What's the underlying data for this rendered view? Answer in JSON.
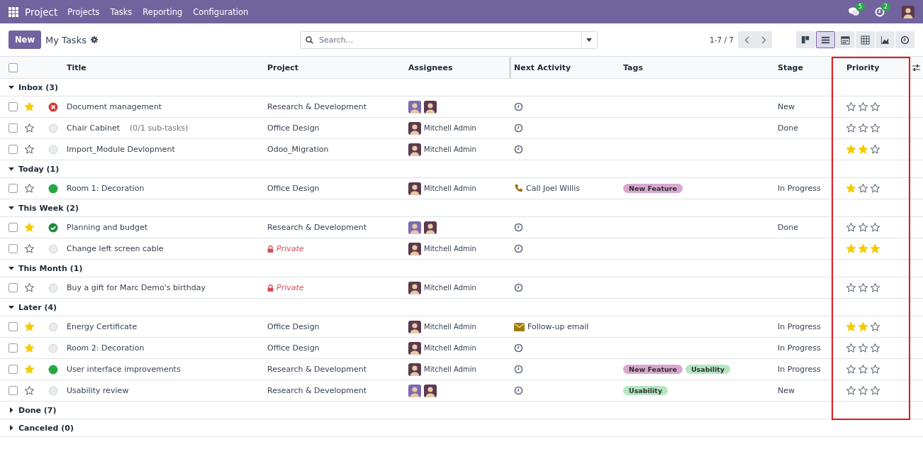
{
  "navbar": {
    "app": "Project",
    "menu": [
      "Projects",
      "Tasks",
      "Reporting",
      "Configuration"
    ],
    "messages_badge": "5",
    "activities_badge": "2"
  },
  "control_panel": {
    "new_button": "New",
    "title": "My Tasks",
    "search": {
      "placeholder": "Search..."
    },
    "pager": "1-7 / 7",
    "views": [
      {
        "kind": "kanban",
        "selected": false
      },
      {
        "kind": "list",
        "selected": true
      },
      {
        "kind": "calendar",
        "selected": false
      },
      {
        "kind": "pivot",
        "selected": false
      },
      {
        "kind": "graph",
        "selected": false
      },
      {
        "kind": "activity",
        "selected": false
      }
    ]
  },
  "table": {
    "all_checked": false,
    "columns": [
      {
        "label": "Title",
        "highlighted": false
      },
      {
        "label": "Project",
        "highlighted": false
      },
      {
        "label": "Assignees",
        "highlighted": false
      },
      {
        "label": "Next Activity",
        "highlighted": false
      },
      {
        "label": "Tags",
        "highlighted": false
      },
      {
        "label": "Stage",
        "highlighted": false
      },
      {
        "label": "Priority",
        "highlighted": true
      }
    ],
    "groups": [
      {
        "label": "Inbox (3)",
        "expanded": true,
        "rows": [
          {
            "checked": false,
            "favorite": true,
            "status": {
              "kind": "blocked"
            },
            "title": "Document management",
            "project": {
              "kind": "normal",
              "label": "Research & Development"
            },
            "avatars": [
              {
                "kind": "demo"
              },
              {
                "kind": "admin"
              }
            ],
            "activity": {
              "kind": "none"
            },
            "stage": "New",
            "stars": 0
          },
          {
            "checked": false,
            "favorite": false,
            "status": {
              "kind": "normal"
            },
            "title": "Chair Cabinet",
            "subtasks": "(0/1 sub-tasks)",
            "project": {
              "kind": "normal",
              "label": "Office Design"
            },
            "avatars": [
              {
                "kind": "admin"
              }
            ],
            "assignee": "Mitchell Admin",
            "activity": {
              "kind": "none"
            },
            "stage": "Done",
            "stars": 0
          },
          {
            "checked": false,
            "favorite": false,
            "status": {
              "kind": "normal"
            },
            "title": "Import_Module Devlopment",
            "project": {
              "kind": "normal",
              "label": "Odoo_Migration"
            },
            "avatars": [
              {
                "kind": "admin"
              }
            ],
            "assignee": "Mitchell Admin",
            "activity": {
              "kind": "none"
            },
            "stars": 2
          }
        ]
      },
      {
        "label": "Today (1)",
        "expanded": true,
        "rows": [
          {
            "checked": false,
            "favorite": false,
            "status": {
              "kind": "ready"
            },
            "title": "Room 1: Decoration",
            "project": {
              "kind": "normal",
              "label": "Office Design"
            },
            "avatars": [
              {
                "kind": "admin"
              }
            ],
            "assignee": "Mitchell Admin",
            "activity": {
              "kind": "call",
              "label": "Call Joel Willis"
            },
            "tags": [
              {
                "label": "New Feature",
                "color": "#d9a7cf"
              }
            ],
            "stage": "In Progress",
            "stars": 1
          }
        ]
      },
      {
        "label": "This Week (2)",
        "expanded": true,
        "rows": [
          {
            "checked": false,
            "favorite": true,
            "status": {
              "kind": "done"
            },
            "title": "Planning and budget",
            "project": {
              "kind": "normal",
              "label": "Research & Development"
            },
            "avatars": [
              {
                "kind": "demo"
              },
              {
                "kind": "admin"
              }
            ],
            "activity": {
              "kind": "none"
            },
            "stage": "Done",
            "stars": 0
          },
          {
            "checked": false,
            "favorite": false,
            "status": {
              "kind": "normal"
            },
            "title": "Change left screen cable",
            "project": {
              "kind": "private",
              "label": "Private"
            },
            "avatars": [
              {
                "kind": "admin"
              }
            ],
            "assignee": "Mitchell Admin",
            "activity": {
              "kind": "none"
            },
            "stars": 3
          }
        ]
      },
      {
        "label": "This Month (1)",
        "expanded": true,
        "rows": [
          {
            "checked": false,
            "favorite": false,
            "status": {
              "kind": "normal"
            },
            "title": "Buy a gift for Marc Demo's birthday",
            "project": {
              "kind": "private",
              "label": "Private"
            },
            "avatars": [
              {
                "kind": "admin"
              }
            ],
            "assignee": "Mitchell Admin",
            "activity": {
              "kind": "none"
            },
            "stars": 0
          }
        ]
      },
      {
        "label": "Later (4)",
        "expanded": true,
        "rows": [
          {
            "checked": false,
            "favorite": true,
            "status": {
              "kind": "normal"
            },
            "title": "Energy Certificate",
            "project": {
              "kind": "normal",
              "label": "Office Design"
            },
            "avatars": [
              {
                "kind": "admin"
              }
            ],
            "assignee": "Mitchell Admin",
            "activity": {
              "kind": "email",
              "label": "Follow-up email"
            },
            "stage": "In Progress",
            "stars": 2
          },
          {
            "checked": false,
            "favorite": true,
            "status": {
              "kind": "normal"
            },
            "title": "Room 2: Decoration",
            "project": {
              "kind": "normal",
              "label": "Office Design"
            },
            "avatars": [
              {
                "kind": "admin"
              }
            ],
            "assignee": "Mitchell Admin",
            "activity": {
              "kind": "none"
            },
            "stage": "In Progress",
            "stars": 0
          },
          {
            "checked": false,
            "favorite": true,
            "status": {
              "kind": "ready"
            },
            "title": "User interface improvements",
            "project": {
              "kind": "normal",
              "label": "Research & Development"
            },
            "avatars": [
              {
                "kind": "admin"
              }
            ],
            "assignee": "Mitchell Admin",
            "activity": {
              "kind": "none"
            },
            "tags": [
              {
                "label": "New Feature",
                "color": "#d9a7cf"
              },
              {
                "label": "Usability",
                "color": "#b3e6c0"
              }
            ],
            "stage": "In Progress",
            "stars": 0
          },
          {
            "checked": false,
            "favorite": false,
            "status": {
              "kind": "normal"
            },
            "title": "Usability review",
            "project": {
              "kind": "normal",
              "label": "Research & Development"
            },
            "avatars": [
              {
                "kind": "demo"
              },
              {
                "kind": "admin"
              }
            ],
            "activity": {
              "kind": "none"
            },
            "tags": [
              {
                "label": "Usability",
                "color": "#b3e6c0"
              }
            ],
            "stage": "New",
            "stars": 0
          }
        ]
      },
      {
        "label": "Done (7)",
        "expanded": false
      },
      {
        "label": "Canceled (0)",
        "expanded": false
      }
    ]
  }
}
